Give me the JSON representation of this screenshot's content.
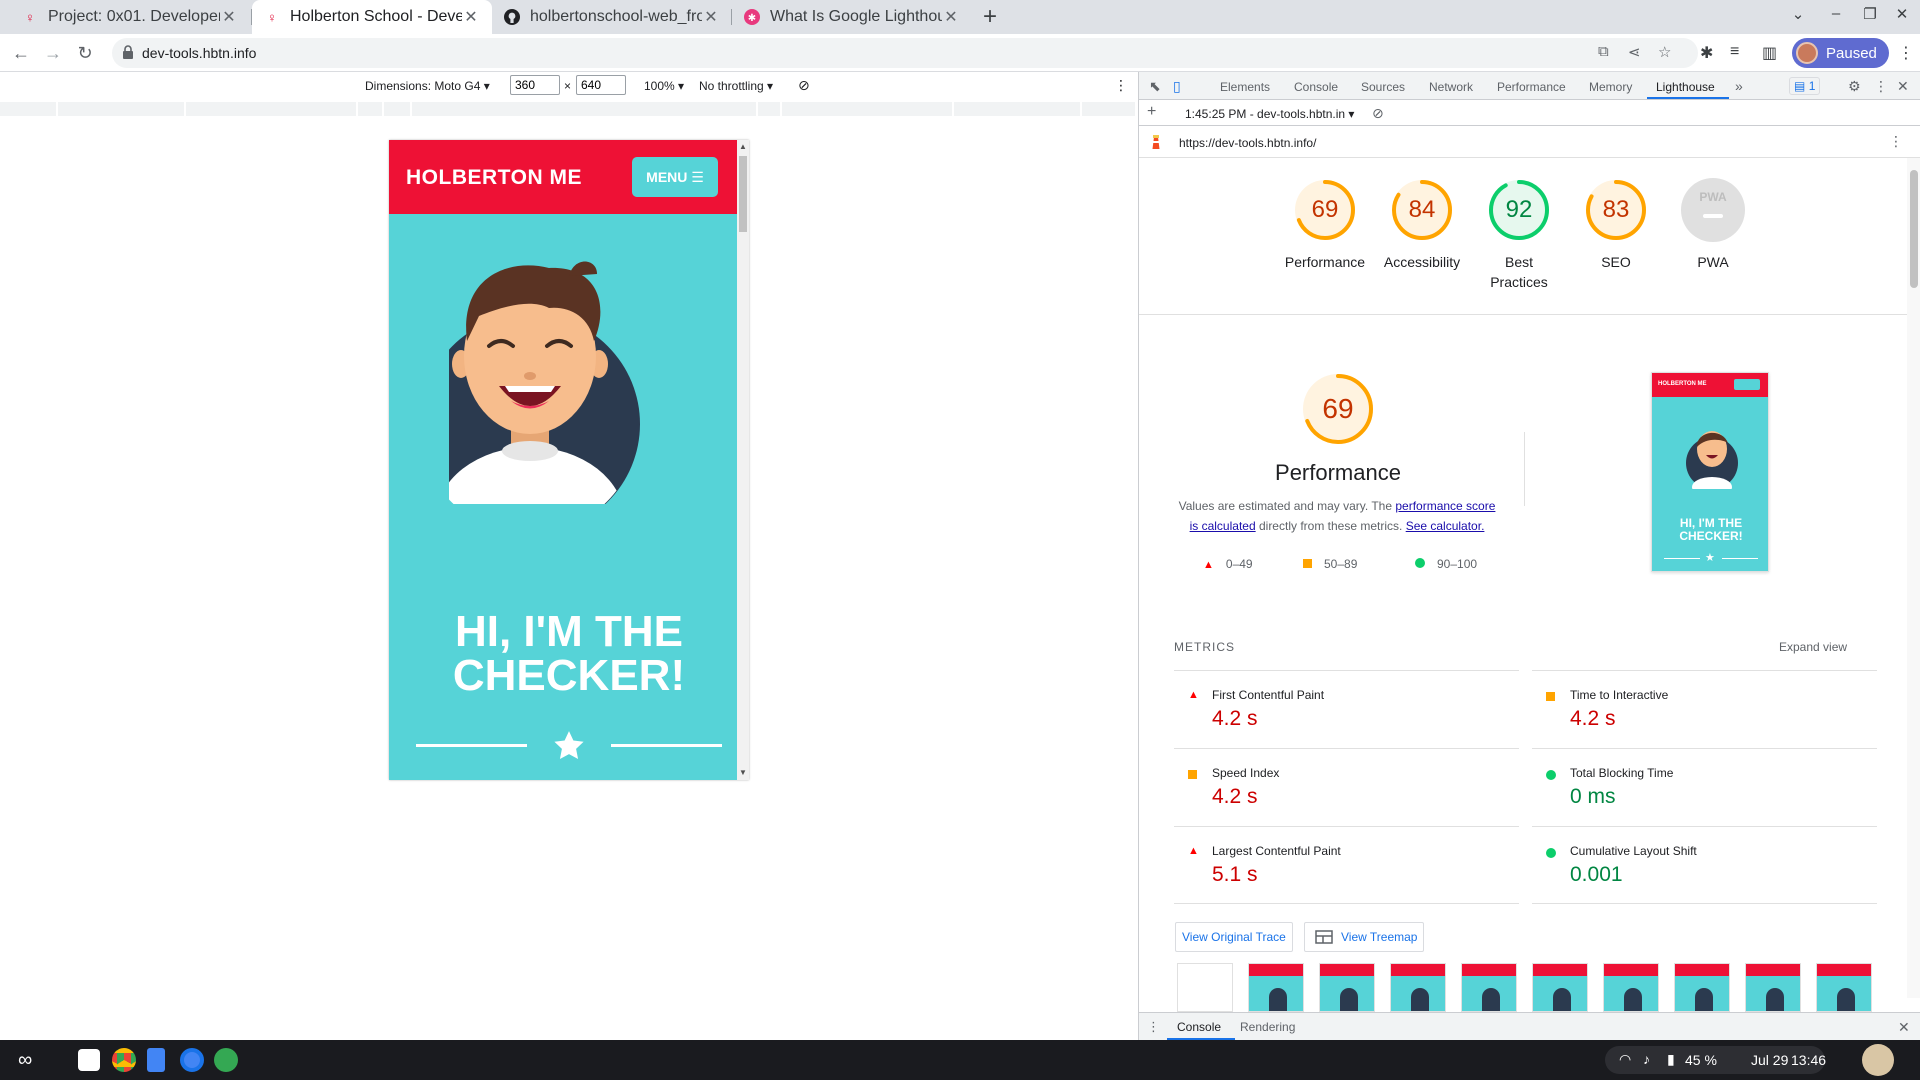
{
  "browser": {
    "tabs": [
      {
        "title": "Project: 0x01. Developer",
        "icon": "holberton-favicon-icon"
      },
      {
        "title": "Holberton School - Deve",
        "icon": "holberton-favicon-icon"
      },
      {
        "title": "holbertonschool-web_fro",
        "icon": "github-icon"
      },
      {
        "title": "What Is Google Lighthou",
        "icon": "pink-favicon-icon"
      }
    ],
    "url": "dev-tools.hbtn.info",
    "profile_label": "Paused"
  },
  "device_toolbar": {
    "dimensions_label": "Dimensions: Moto G4 ▾",
    "width": "360",
    "times": "×",
    "height": "640",
    "zoom": "100% ▾",
    "throttling": "No throttling ▾"
  },
  "phone": {
    "logo": "HOLBERTON ME",
    "menu_label": "MENU ☰",
    "hero_line1": "HI, I'M THE",
    "hero_line2": "CHECKER!"
  },
  "devtools": {
    "tabs": [
      "Elements",
      "Console",
      "Sources",
      "Network",
      "Performance",
      "Memory",
      "Lighthouse"
    ],
    "more": "»",
    "issues_badge": "1",
    "report_time": "1:45:25 PM - dev-tools.hbtn.in ▾",
    "report_url": "https://dev-tools.hbtn.info/",
    "drawer_tabs": [
      "Console",
      "Rendering"
    ]
  },
  "lighthouse": {
    "categories": [
      {
        "label": "Performance",
        "score": 69,
        "color": "#fa3"
      },
      {
        "label": "Accessibility",
        "score": 84,
        "color": "#fa3"
      },
      {
        "label": "Best",
        "label2": "Practices",
        "score": 92,
        "color": "#0c6"
      },
      {
        "label": "SEO",
        "score": 83,
        "color": "#fa3"
      },
      {
        "label": "PWA",
        "score": null,
        "color": "#999"
      }
    ],
    "pwa_badge": "PWA",
    "perf_score": 69,
    "perf_title": "Performance",
    "desc_pre": "Values are estimated and may vary. The ",
    "desc_link1": "performance score is calculated",
    "desc_mid": " directly from these metrics. ",
    "desc_link2": "See calculator.",
    "legend": [
      "0–49",
      "50–89",
      "90–100"
    ],
    "metrics_title": "METRICS",
    "expand_label": "Expand view",
    "metrics": [
      {
        "name": "First Contentful Paint",
        "value": "4.2 s",
        "status": "fail"
      },
      {
        "name": "Time to Interactive",
        "value": "4.2 s",
        "status": "fail"
      },
      {
        "name": "Speed Index",
        "value": "4.2 s",
        "status": "fail"
      },
      {
        "name": "Total Blocking Time",
        "value": "0 ms",
        "status": "pass"
      },
      {
        "name": "Largest Contentful Paint",
        "value": "5.1 s",
        "status": "fail"
      },
      {
        "name": "Cumulative Layout Shift",
        "value": "0.001",
        "status": "pass"
      }
    ],
    "view_trace": "View Original Trace",
    "view_treemap": "View Treemap",
    "thumb_logo": "HOLBERTON ME",
    "thumb_title": "HI, I'M THE CHECKER!"
  },
  "shelf": {
    "battery": "45 %",
    "date": "Jul 29",
    "time": "13:46"
  }
}
